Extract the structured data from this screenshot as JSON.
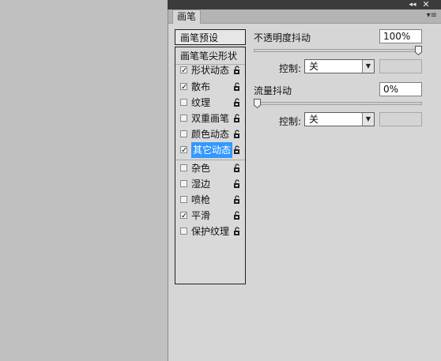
{
  "panel": {
    "tab_label": "画笔",
    "collapse_icon": "double-chevron-right-icon",
    "close_icon": "close-icon",
    "menu_icon": "panel-menu-icon"
  },
  "brush_list": {
    "presets_button": "画笔预设",
    "tip_shape": "画笔笔尖形状",
    "items": [
      {
        "label": "形状动态",
        "checked": true
      },
      {
        "label": "散布",
        "checked": true
      },
      {
        "label": "纹理",
        "checked": false
      },
      {
        "label": "双重画笔",
        "checked": false
      },
      {
        "label": "颜色动态",
        "checked": false
      },
      {
        "label": "其它动态",
        "checked": true,
        "selected": true
      },
      {
        "label": "杂色",
        "checked": false
      },
      {
        "label": "湿边",
        "checked": false
      },
      {
        "label": "喷枪",
        "checked": false
      },
      {
        "label": "平滑",
        "checked": true
      },
      {
        "label": "保护纹理",
        "checked": false
      }
    ],
    "lock_icon": "lock-icon"
  },
  "other_dynamics": {
    "opacity_jitter": {
      "label": "不透明度抖动",
      "value": "100%",
      "slider_fraction": 1.0
    },
    "opacity_control": {
      "label": "控制:",
      "selected": "关"
    },
    "flow_jitter": {
      "label": "流量抖动",
      "value": "0%",
      "slider_fraction": 0.0
    },
    "flow_control": {
      "label": "控制:",
      "selected": "关"
    }
  }
}
